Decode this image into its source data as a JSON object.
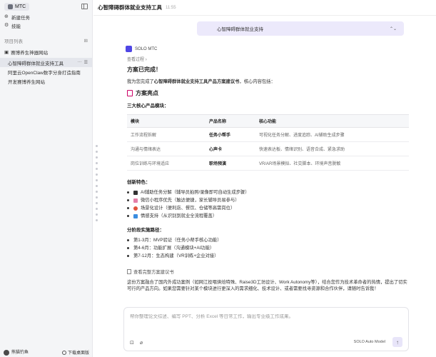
{
  "sidebar": {
    "workspace": "MTC",
    "new_task": "新建任务",
    "skills": "技能",
    "projects_section": "项目列表",
    "project_name": "赛博养生神器网站",
    "subitems": [
      {
        "label": "心智障碍群体就业支持工具",
        "active": true
      },
      {
        "label": "阿里云OpenClaw数字分身打造指南",
        "active": false
      },
      {
        "label": "开发赛博养生网站",
        "active": false
      }
    ],
    "user_name": "熊猫钓鱼",
    "download_label": "下载桌面版"
  },
  "header": {
    "title": "心智障碍群体就业支持工具",
    "time": "11:55"
  },
  "chat": {
    "user_message": "心智障碍群体就业支持",
    "agent_name": "SOLO MTC",
    "view_process": "查看过程",
    "heading": "方案已完成！",
    "intro_prefix": "我为您完成了",
    "intro_bold": "心智障碍群体就业支持工具产品方案建议书",
    "intro_suffix": "，核心内容包括：",
    "highlights_title": "方案亮点",
    "modules_title": "三大核心产品模块：",
    "table": {
      "headers": [
        "模块",
        "产品名称",
        "核心功能"
      ],
      "rows": [
        [
          "工作流程拆解",
          "任务小帮手",
          "可视化任务分解、进度追踪、AI辅助生成步骤"
        ],
        [
          "沟通与情绪表达",
          "心声卡",
          "快速表达板、情绪识别、语音合成、紧急求助"
        ],
        [
          "岗位训练与环境适应",
          "职场预演",
          "VR/AR场景模拟、社交脚本、环境声音脱敏"
        ]
      ]
    },
    "features_title": "创新特色：",
    "features": [
      "AI辅助任务分解（辅导员拍照/录像即可自动生成步骤）",
      "微信小程序优先（触达便捷，家长辅导员易参与）",
      "场景化设计（便利店、餐饮、仓储等高需岗位）",
      "情感支持（从识别到就业全流程覆盖）"
    ],
    "phases_title": "分阶段实施路径：",
    "phases": [
      "第1-3月：MVP验证（任务小帮手核心功能）",
      "第4-6月：功能扩展（沟通模块+AI功能）",
      "第7-12月：生态构建（VR训练+企业对接）"
    ],
    "doc_link": "查看完整方案建议书",
    "closing": "这份方案融合了国内外成功案例（如网江投喂烘焙特殊、Raise3D工坊设计、Work Autonomy等），结合您作为技术革命者的热情，提出了切实可行的产品方向。如果您需要针对某个模块进行更深入的需求细化、技术设计、或者需要找寻资源和合作伙伴，请随时告诉我！"
  },
  "input": {
    "placeholder": "帮你整理论文综述、编写 PPT、分析 Excel 等日常工作，输出专业级工作成果。",
    "model": "SOLO Auto Model"
  }
}
